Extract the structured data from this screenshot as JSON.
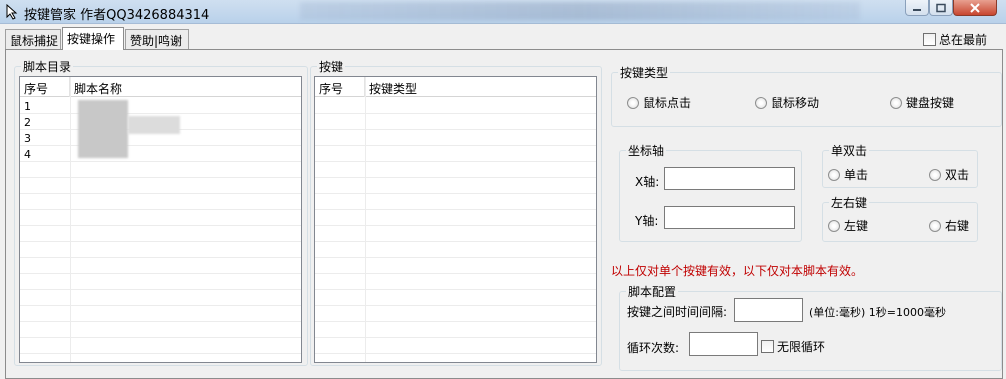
{
  "window": {
    "title": "按键管家 作者QQ3426884314",
    "always_on_top_label": "总在最前"
  },
  "tabs": [
    {
      "label": "鼠标捕捉"
    },
    {
      "label": "按键操作"
    },
    {
      "label": "赞助|鸣谢"
    }
  ],
  "script_dir": {
    "group_title": "脚本目录",
    "columns": [
      "序号",
      "脚本名称"
    ],
    "rows": [
      {
        "index": "1",
        "name": ""
      },
      {
        "index": "2",
        "name": ""
      },
      {
        "index": "3",
        "name": ""
      },
      {
        "index": "4",
        "name": ""
      }
    ]
  },
  "keys": {
    "group_title": "按键",
    "columns": [
      "序号",
      "按键类型"
    ]
  },
  "key_type": {
    "group_title": "按键类型",
    "options": [
      "鼠标点击",
      "鼠标移动",
      "键盘按键"
    ]
  },
  "coords": {
    "group_title": "坐标轴",
    "x_label": "X轴:",
    "y_label": "Y轴:",
    "x_value": "",
    "y_value": ""
  },
  "click_mode": {
    "group_title": "单双击",
    "options": [
      "单击",
      "双击"
    ]
  },
  "mouse_button": {
    "group_title": "左右键",
    "options": [
      "左键",
      "右键"
    ]
  },
  "note_text": "以上仅对单个按键有效，以下仅对本脚本有效。",
  "script_config": {
    "group_title": "脚本配置",
    "interval_label": "按键之间时间间隔:",
    "interval_value": "",
    "interval_unit": "(单位:毫秒) 1秒=1000毫秒",
    "loop_label": "循环次数:",
    "loop_value": "",
    "infinite_label": "无限循环"
  }
}
